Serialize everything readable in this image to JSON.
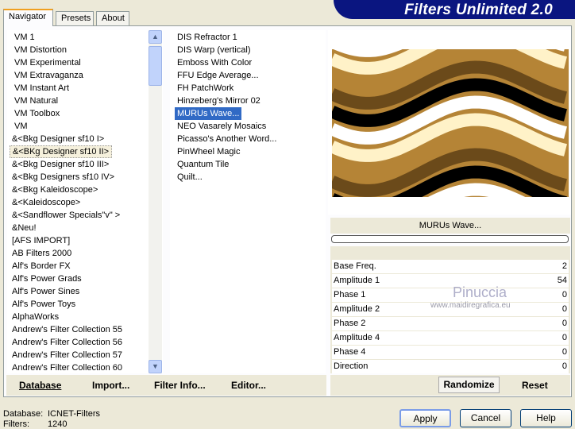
{
  "app": {
    "title": "Filters Unlimited 2.0"
  },
  "tabs": [
    {
      "label": "Navigator"
    },
    {
      "label": "Presets"
    },
    {
      "label": "About"
    }
  ],
  "categories": [
    "VM 1",
    "VM Distortion",
    "VM Experimental",
    "VM Extravaganza",
    "VM Instant Art",
    "VM Natural",
    "VM Toolbox",
    "VM",
    "&<Bkg Designer sf10 I>",
    "&<BKg Designer sf10 II>",
    "&<Bkg Designer sf10 III>",
    "&<Bkg Designers sf10 IV>",
    "&<Bkg Kaleidoscope>",
    "&<Kaleidoscope>",
    "&<Sandflower Specials\"v\" >",
    "&Neu!",
    "[AFS IMPORT]",
    "AB Filters 2000",
    "Alf's Border FX",
    "Alf's Power Grads",
    "Alf's Power Sines",
    "Alf's Power Toys",
    "AlphaWorks",
    "Andrew's Filter Collection 55",
    "Andrew's Filter Collection 56",
    "Andrew's Filter Collection 57",
    "Andrew's Filter Collection 60"
  ],
  "selected_category": "&<BKg Designer sf10 II>",
  "filters": [
    "DIS Refractor 1",
    "DIS Warp (vertical)",
    "Emboss With Color",
    "FFU Edge Average...",
    "FH PatchWork",
    "Hinzeberg's Mirror 02",
    "MURUs Wave...",
    "NEO Vasarely Mosaics",
    "Picasso's Another Word...",
    "PinWheel Magic",
    "Quantum Tile",
    "Quilt..."
  ],
  "selected_filter": "MURUs Wave...",
  "preview": {
    "filter_name": "MURUs Wave...",
    "progress": 0,
    "colors": [
      "#000000",
      "#ffffff",
      "#fff2c8",
      "#b58436",
      "#6b4a1a"
    ]
  },
  "parameters": [
    {
      "name": "Base Freq.",
      "value": "2"
    },
    {
      "name": "Amplitude 1",
      "value": "54"
    },
    {
      "name": "Phase 1",
      "value": "0"
    },
    {
      "name": "Amplitude 2",
      "value": "0"
    },
    {
      "name": "Phase 2",
      "value": "0"
    },
    {
      "name": "Amplitude 4",
      "value": "0"
    },
    {
      "name": "Phase 4",
      "value": "0"
    },
    {
      "name": "Direction",
      "value": "0"
    }
  ],
  "watermark": {
    "name": "Pinuccia",
    "url": "www.maidiregrafica.eu"
  },
  "toolbar": {
    "database": "Database",
    "import": "Import...",
    "filter_info": "Filter Info...",
    "editor": "Editor...",
    "randomize": "Randomize",
    "reset": "Reset"
  },
  "status": {
    "database_label": "Database:",
    "database_value": "ICNET-Filters",
    "filters_label": "Filters:",
    "filters_value": "1240"
  },
  "buttons": {
    "apply": "Apply",
    "cancel": "Cancel",
    "help": "Help"
  }
}
